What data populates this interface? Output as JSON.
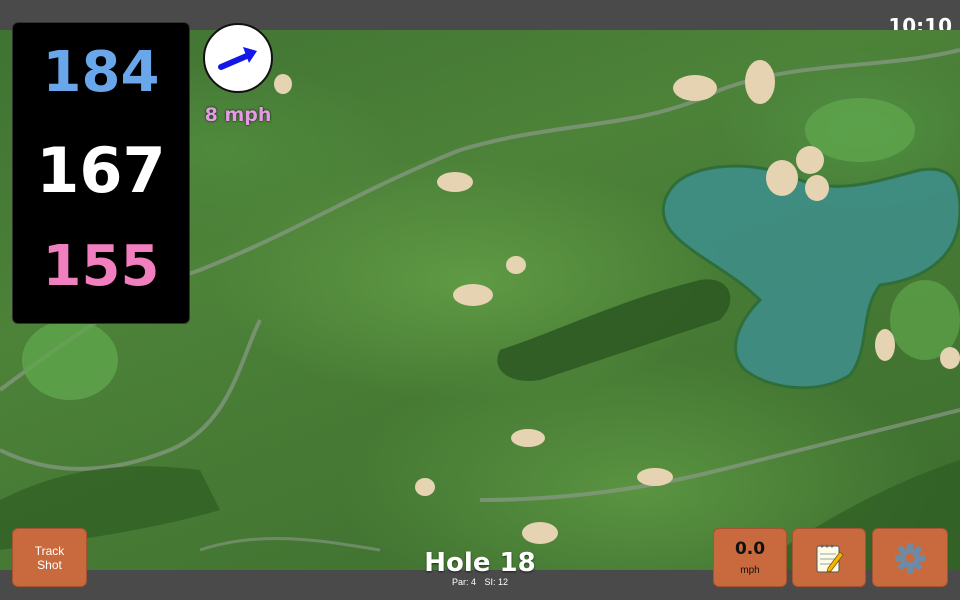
{
  "status": {
    "time": "10:10"
  },
  "distances": {
    "back": "184",
    "middle": "167",
    "front": "155"
  },
  "wind": {
    "speed_label": "8 mph",
    "icon": "wind-arrow-icon"
  },
  "hole": {
    "title": "Hole 18",
    "par": "Par: 4",
    "stroke_index": "SI: 12"
  },
  "buttons": {
    "track_line1": "Track",
    "track_line2": "Shot",
    "shot_speed_value": "0.0",
    "shot_speed_unit": "mph",
    "notes_icon": "notepad-icon",
    "settings_icon": "gear-icon"
  },
  "colors": {
    "back_distance": "#6aa7ea",
    "middle_distance": "#ffffff",
    "front_distance": "#f17fbf",
    "button": "#c86a3e",
    "wind_label": "#e59ae6"
  }
}
